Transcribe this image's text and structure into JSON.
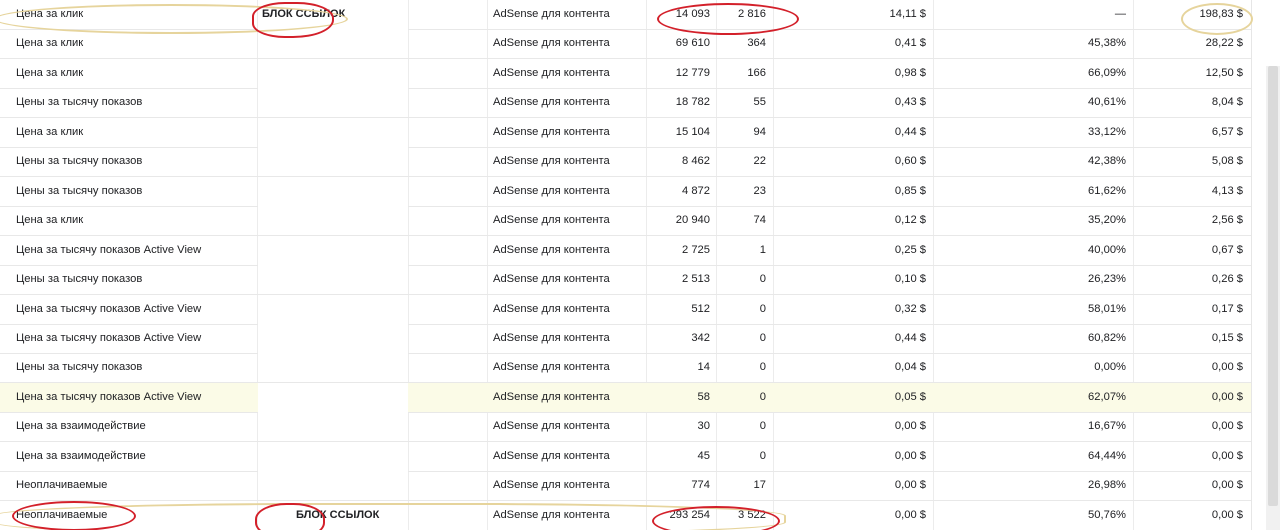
{
  "rows": [
    {
      "type": "Цена за клик",
      "block": "БЛОК ССЫЛОК",
      "product": "AdSense для контента",
      "impressions": "14 093",
      "clicks": "2 816",
      "cpc": "14,11 $",
      "ctr": "—",
      "revenue": "198,83 $"
    },
    {
      "type": "Цена за клик",
      "block": "",
      "product": "AdSense для контента",
      "impressions": "69 610",
      "clicks": "364",
      "cpc": "0,41 $",
      "ctr": "45,38%",
      "revenue": "28,22 $"
    },
    {
      "type": "Цена за клик",
      "block": "",
      "product": "AdSense для контента",
      "impressions": "12 779",
      "clicks": "166",
      "cpc": "0,98 $",
      "ctr": "66,09%",
      "revenue": "12,50 $"
    },
    {
      "type": "Цены за тысячу показов",
      "block": "",
      "product": "AdSense для контента",
      "impressions": "18 782",
      "clicks": "55",
      "cpc": "0,43 $",
      "ctr": "40,61%",
      "revenue": "8,04 $"
    },
    {
      "type": "Цена за клик",
      "block": "",
      "product": "AdSense для контента",
      "impressions": "15 104",
      "clicks": "94",
      "cpc": "0,44 $",
      "ctr": "33,12%",
      "revenue": "6,57 $"
    },
    {
      "type": "Цены за тысячу показов",
      "block": "",
      "product": "AdSense для контента",
      "impressions": "8 462",
      "clicks": "22",
      "cpc": "0,60 $",
      "ctr": "42,38%",
      "revenue": "5,08 $"
    },
    {
      "type": "Цены за тысячу показов",
      "block": "",
      "product": "AdSense для контента",
      "impressions": "4 872",
      "clicks": "23",
      "cpc": "0,85 $",
      "ctr": "61,62%",
      "revenue": "4,13 $"
    },
    {
      "type": "Цена за клик",
      "block": "",
      "product": "AdSense для контента",
      "impressions": "20 940",
      "clicks": "74",
      "cpc": "0,12 $",
      "ctr": "35,20%",
      "revenue": "2,56 $"
    },
    {
      "type": "Цена за тысячу показов Active View",
      "block": "",
      "product": "AdSense для контента",
      "impressions": "2 725",
      "clicks": "1",
      "cpc": "0,25 $",
      "ctr": "40,00%",
      "revenue": "0,67 $"
    },
    {
      "type": "Цены за тысячу показов",
      "block": "",
      "product": "AdSense для контента",
      "impressions": "2 513",
      "clicks": "0",
      "cpc": "0,10 $",
      "ctr": "26,23%",
      "revenue": "0,26 $"
    },
    {
      "type": "Цена за тысячу показов Active View",
      "block": "",
      "product": "AdSense для контента",
      "impressions": "512",
      "clicks": "0",
      "cpc": "0,32 $",
      "ctr": "58,01%",
      "revenue": "0,17 $"
    },
    {
      "type": "Цена за тысячу показов Active View",
      "block": "",
      "product": "AdSense для контента",
      "impressions": "342",
      "clicks": "0",
      "cpc": "0,44 $",
      "ctr": "60,82%",
      "revenue": "0,15 $"
    },
    {
      "type": "Цены за тысячу показов",
      "block": "",
      "product": "AdSense для контента",
      "impressions": "14",
      "clicks": "0",
      "cpc": "0,04 $",
      "ctr": "0,00%",
      "revenue": "0,00 $"
    },
    {
      "type": "Цена за тысячу показов Active View",
      "block": "",
      "product": "AdSense для контента",
      "impressions": "58",
      "clicks": "0",
      "cpc": "0,05 $",
      "ctr": "62,07%",
      "revenue": "0,00 $"
    },
    {
      "type": "Цена за взаимодействие",
      "block": "",
      "product": "AdSense для контента",
      "impressions": "30",
      "clicks": "0",
      "cpc": "0,00 $",
      "ctr": "16,67%",
      "revenue": "0,00 $"
    },
    {
      "type": "Цена за взаимодействие",
      "block": "",
      "product": "AdSense для контента",
      "impressions": "45",
      "clicks": "0",
      "cpc": "0,00 $",
      "ctr": "64,44%",
      "revenue": "0,00 $"
    },
    {
      "type": "Неоплачиваемые",
      "block": "",
      "product": "AdSense для контента",
      "impressions": "774",
      "clicks": "17",
      "cpc": "0,00 $",
      "ctr": "26,98%",
      "revenue": "0,00 $"
    },
    {
      "type": "Неоплачиваемые",
      "block": "БЛОК ССЫЛОК",
      "product": "AdSense для контента",
      "impressions": "293 254",
      "clicks": "3 522",
      "cpc": "0,00 $",
      "ctr": "50,76%",
      "revenue": "0,00 $"
    }
  ],
  "highlighted_row": 13,
  "colors": {
    "annotation_red": "#d3202a",
    "annotation_yellow": "#e6d49c",
    "highlight_row": "#fbfbe7",
    "grid_line": "#e8e8e8"
  }
}
